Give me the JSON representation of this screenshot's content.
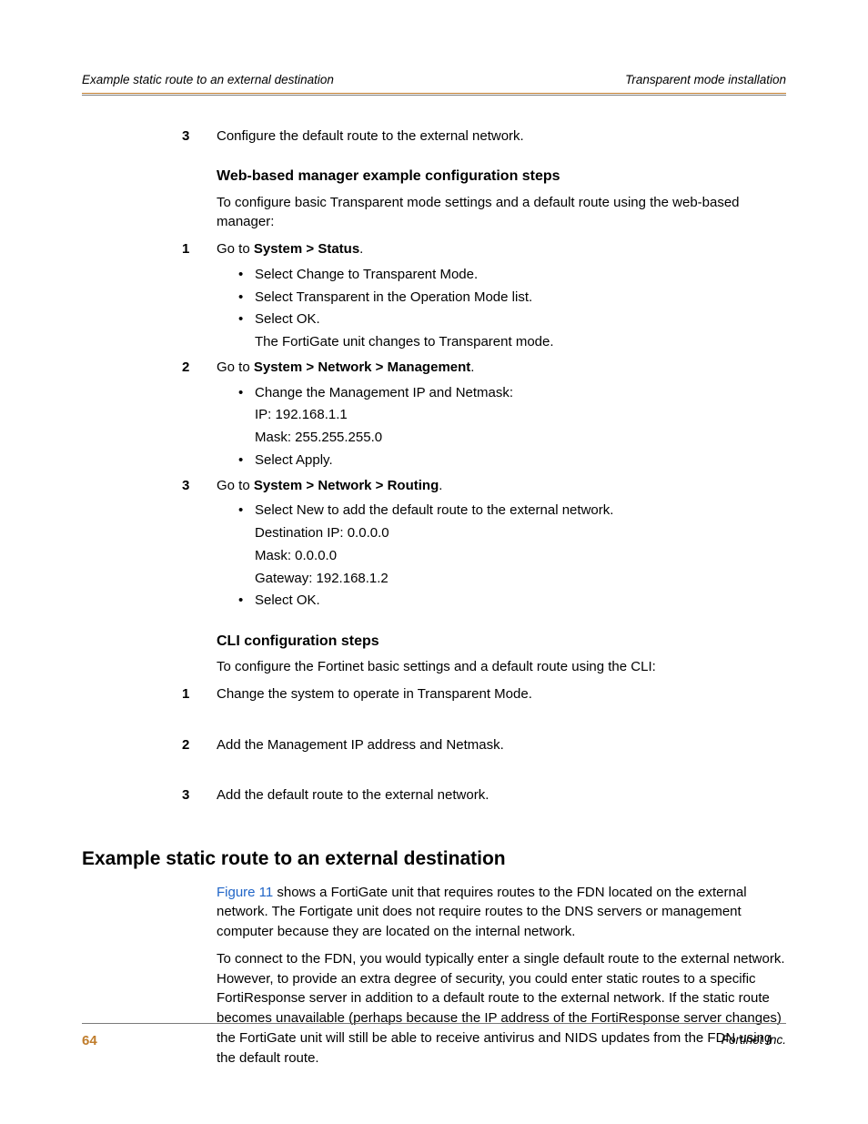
{
  "header": {
    "left": "Example static route to an external destination",
    "right": "Transparent mode installation"
  },
  "top_step": {
    "num": "3",
    "text": "Configure the default route to the external network."
  },
  "web": {
    "heading": "Web-based manager example configuration steps",
    "intro": "To configure basic Transparent mode settings and a default route using the web-based manager:",
    "s1": {
      "num": "1",
      "pre": "Go to ",
      "bold": "System > Status",
      "post": ".",
      "b1": "Select Change to Transparent Mode.",
      "b2": "Select Transparent in the Operation Mode list.",
      "b3": "Select OK.",
      "note": "The FortiGate unit changes to Transparent mode."
    },
    "s2": {
      "num": "2",
      "pre": "Go to ",
      "bold": "System > Network > Management",
      "post": ".",
      "b1": "Change the Management IP and Netmask:",
      "ip": "IP: 192.168.1.1",
      "mask": "Mask: 255.255.255.0",
      "b2": "Select Apply."
    },
    "s3": {
      "num": "3",
      "pre": "Go to ",
      "bold": "System > Network > Routing",
      "post": ".",
      "b1": "Select New to add the default route to the external network.",
      "dip": "Destination IP: 0.0.0.0",
      "mask": "Mask: 0.0.0.0",
      "gw": "Gateway: 192.168.1.2",
      "b2": "Select OK."
    }
  },
  "cli": {
    "heading": "CLI configuration steps",
    "intro": "To configure the Fortinet basic settings and a default route using the CLI:",
    "s1": {
      "num": "1",
      "text": "Change the system to operate in Transparent Mode."
    },
    "s2": {
      "num": "2",
      "text": "Add the Management IP address and Netmask."
    },
    "s3": {
      "num": "3",
      "text": "Add the default route to the external network."
    }
  },
  "section": {
    "title": "Example static route to an external destination",
    "p1_link": "Figure 11",
    "p1_rest": " shows a FortiGate unit that requires routes to the FDN located on the external network. The Fortigate unit does not require routes to the DNS servers or management computer because they are located on the internal network.",
    "p2": "To connect to the FDN, you would typically enter a single default route to the external network. However, to provide an extra degree of security, you could enter static routes to a specific FortiResponse server in addition to a default route to the external network. If the static route becomes unavailable (perhaps because the IP address of the FortiResponse server changes) the FortiGate unit will still be able to receive antivirus and NIDS updates from the FDN using the default route."
  },
  "footer": {
    "page": "64",
    "right": "Fortinet Inc."
  }
}
